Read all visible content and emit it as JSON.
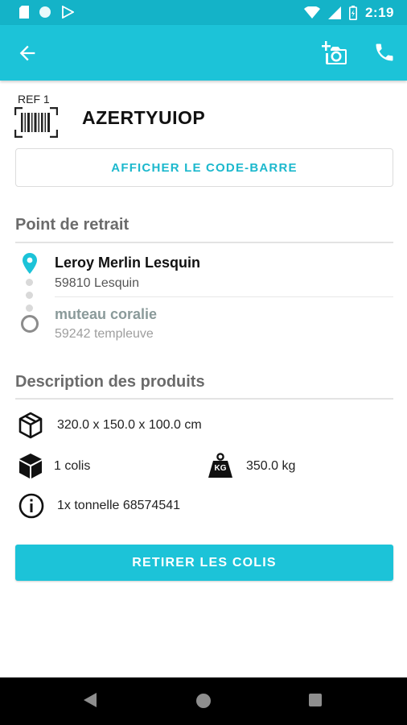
{
  "status_bar": {
    "time": "2:19",
    "left_icons": [
      "sd-card-icon",
      "sync-circle-icon",
      "play-store-icon"
    ],
    "right_icons": [
      "wifi-icon",
      "cell-signal-icon",
      "battery-icon"
    ]
  },
  "app_bar": {
    "back_icon": "arrow-left-icon",
    "action_icons": [
      "add-photo-icon",
      "phone-icon"
    ],
    "background": "#1cc3d8"
  },
  "reference": {
    "label": "REF 1",
    "code": "AZERTYUIOP"
  },
  "barcode_button": {
    "label": "AFFICHER LE CODE-BARRE"
  },
  "pickup_section": {
    "title": "Point de retrait",
    "origin": {
      "name": "Leroy Merlin Lesquin",
      "city": "59810 Lesquin"
    },
    "destination": {
      "name": "muteau coralie",
      "city": "59242 templeuve"
    }
  },
  "products_section": {
    "title": "Description des produits",
    "dimensions": "320.0 x 150.0 x 100.0 cm",
    "package_count": "1 colis",
    "weight_badge": "KG",
    "weight": "350.0 kg",
    "item": "1x tonnelle 68574541"
  },
  "action_button": {
    "label": "RETIRER LES COLIS"
  },
  "colors": {
    "accent": "#1cc3d8",
    "accent_text": "#1cb8cd",
    "section_title": "#6b6b6b",
    "muted_name": "#8a9a9a",
    "muted_city": "#9e9e9e"
  },
  "nav_bar": {
    "icons": [
      "nav-back-icon",
      "nav-home-icon",
      "nav-recents-icon"
    ]
  }
}
